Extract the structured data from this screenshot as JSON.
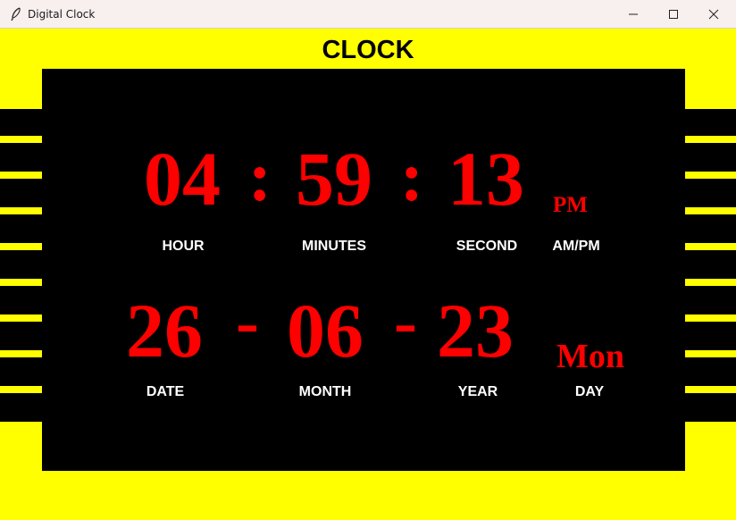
{
  "window": {
    "title": "Digital Clock"
  },
  "heading": "CLOCK",
  "time": {
    "hour": "04",
    "minutes": "59",
    "second": "13",
    "ampm": "PM",
    "separator": ":"
  },
  "time_labels": {
    "hour": "HOUR",
    "minutes": "MINUTES",
    "second": "SECOND",
    "ampm": "AM/PM"
  },
  "date": {
    "date": "26",
    "month": "06",
    "year": "23",
    "day": "Mon",
    "separator": "-"
  },
  "date_labels": {
    "date": "DATE",
    "month": "MONTH",
    "year": "YEAR",
    "day": "DAY"
  },
  "colors": {
    "background": "#ffff00",
    "panel": "#000000",
    "digits": "#ff0000",
    "labels": "#ffffff"
  },
  "icons": {
    "app": "feather-icon",
    "minimize": "minimize-icon",
    "maximize": "maximize-icon",
    "close": "close-icon"
  }
}
